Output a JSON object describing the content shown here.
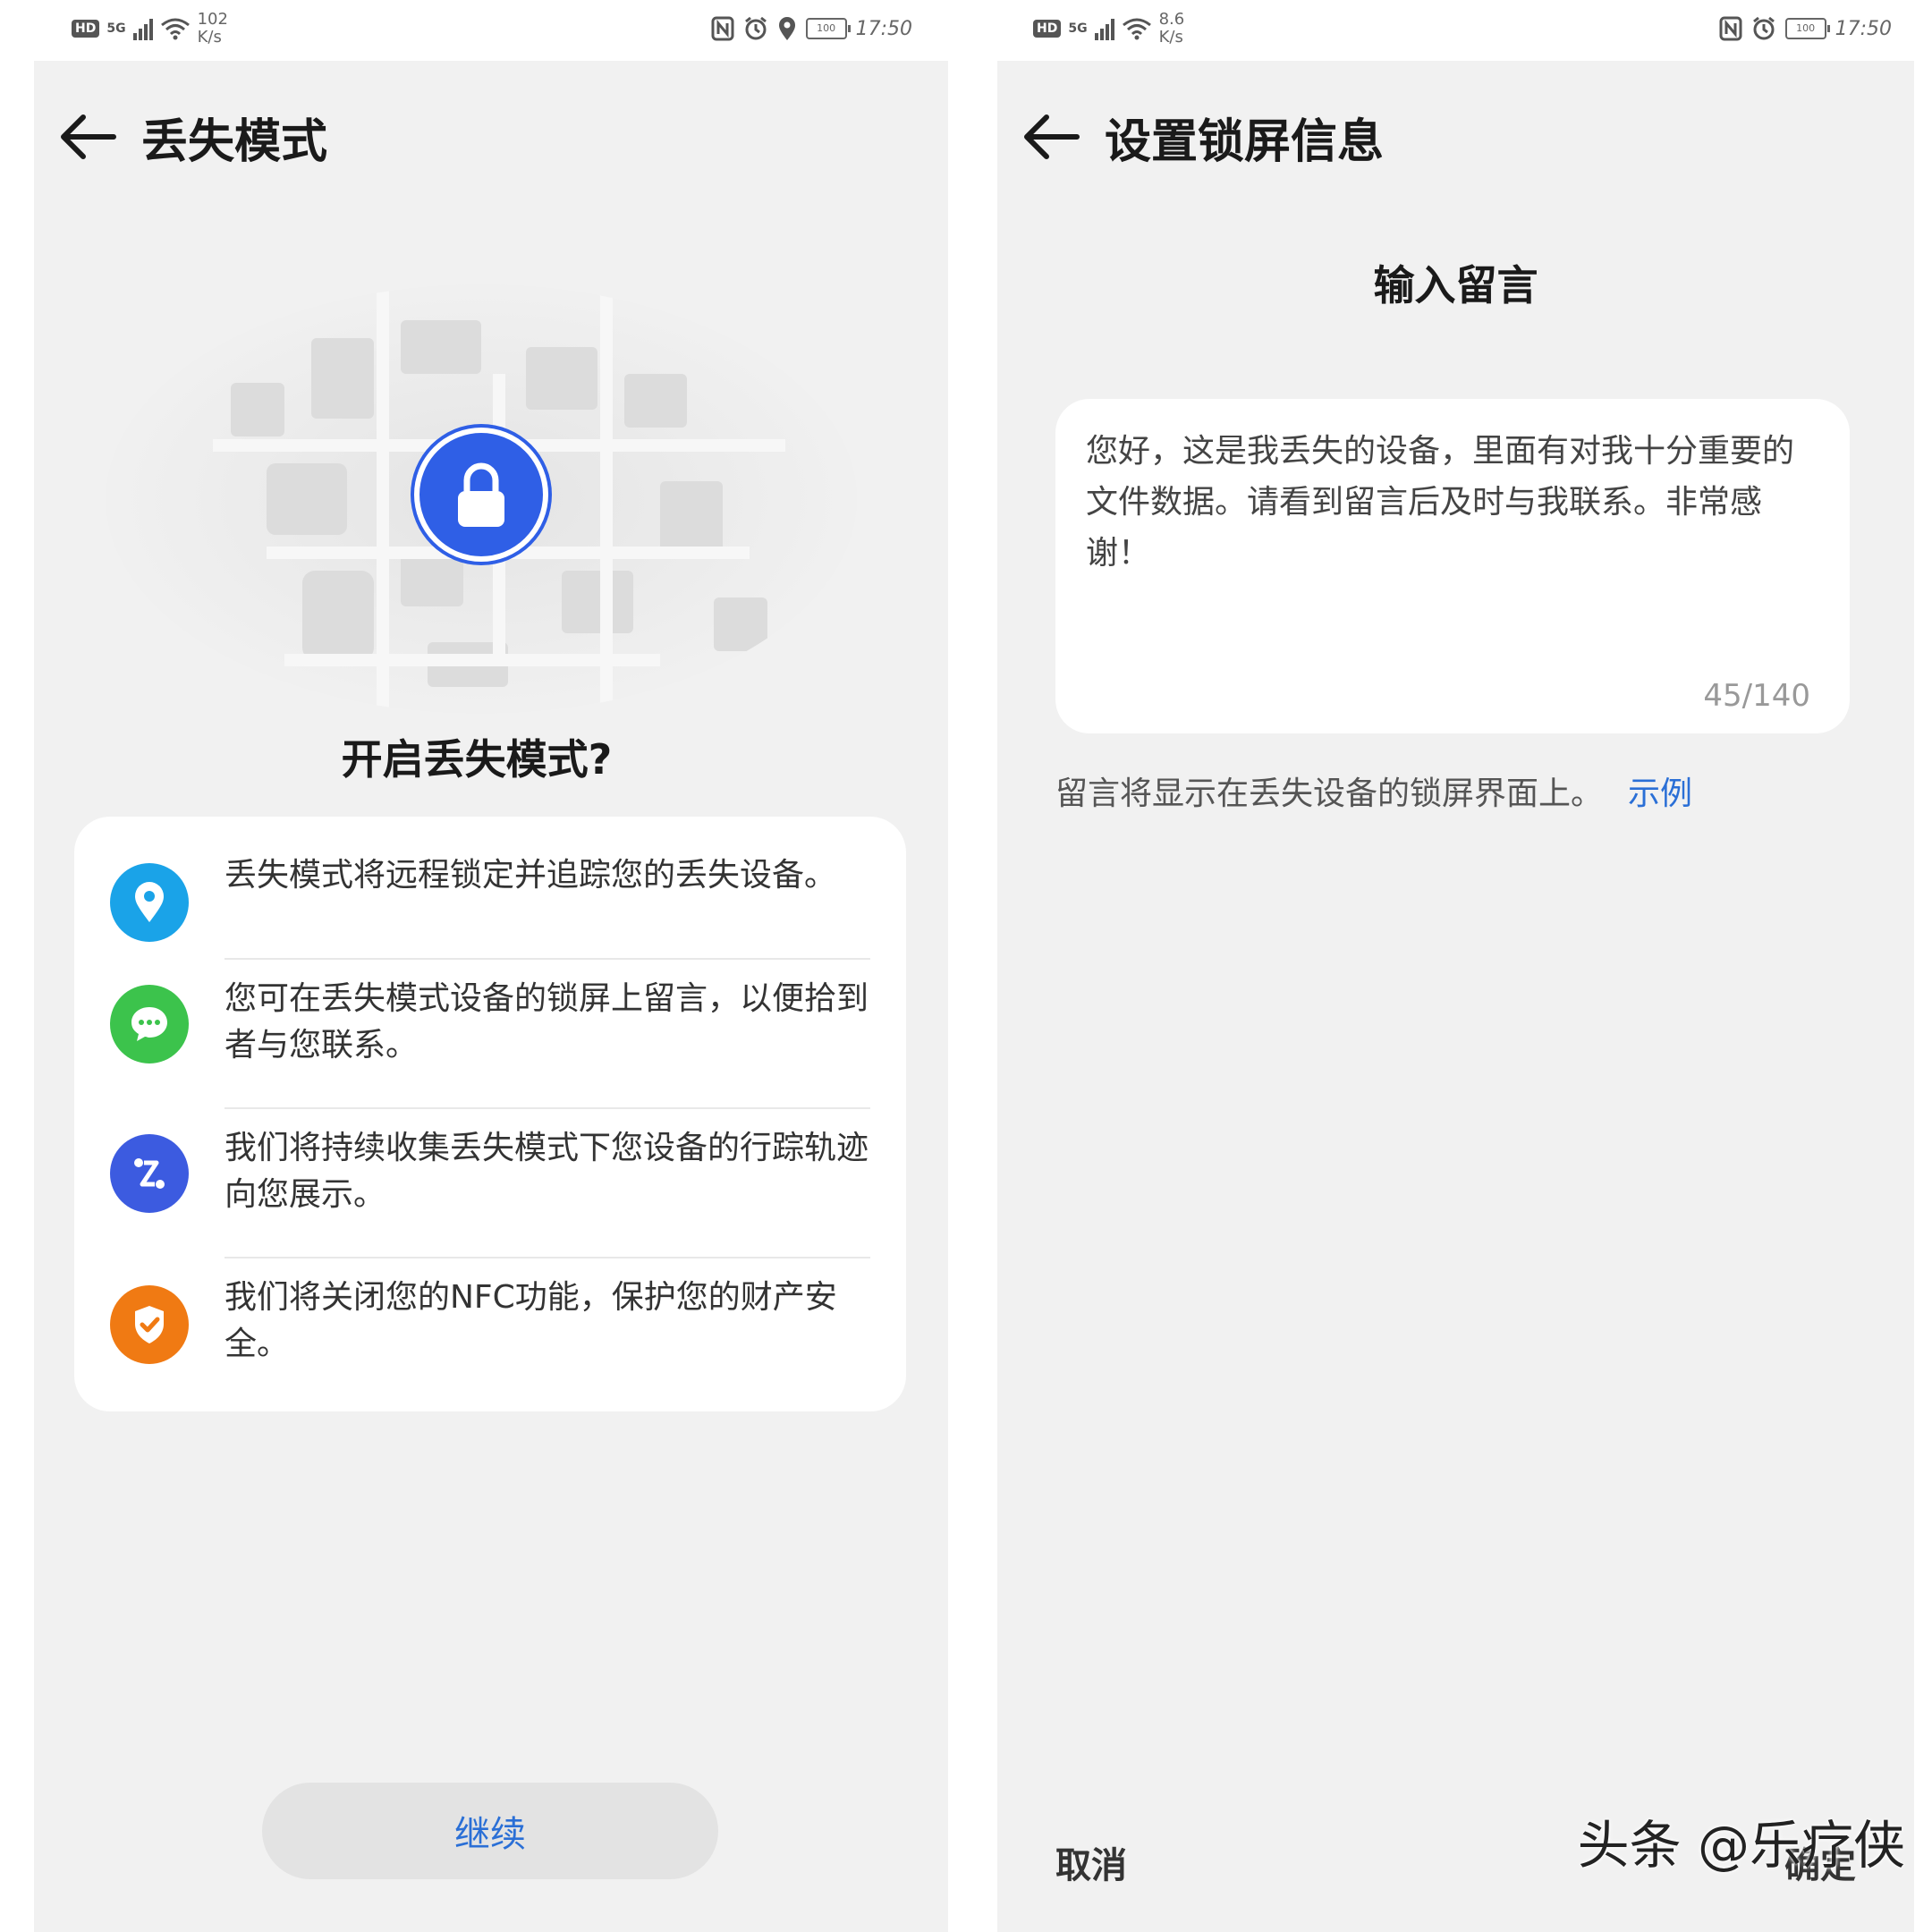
{
  "left": {
    "status": {
      "hd": "HD",
      "net": "5G",
      "speed_value": "102",
      "speed_unit": "K/s",
      "battery": "100",
      "time": "17:50"
    },
    "title": "丢失模式",
    "question": "开启丢失模式?",
    "items": [
      {
        "text": "丢失模式将远程锁定并追踪您的丢失设备。",
        "icon": "location-pin-icon",
        "color": "#1aa3e8"
      },
      {
        "text": "您可在丢失模式设备的锁屏上留言，以便拾到者与您联系。",
        "icon": "message-bubble-icon",
        "color": "#3cc34c"
      },
      {
        "text": "我们将持续收集丢失模式下您设备的行踪轨迹向您展示。",
        "icon": "route-icon",
        "color": "#3c5be0"
      },
      {
        "text": "我们将关闭您的NFC功能，保护您的财产安全。",
        "icon": "shield-check-icon",
        "color": "#f07a13"
      }
    ],
    "continue_label": "继续"
  },
  "right": {
    "status": {
      "hd": "HD",
      "net": "5G",
      "speed_value": "8.6",
      "speed_unit": "K/s",
      "battery": "100",
      "time": "17:50"
    },
    "title": "设置锁屏信息",
    "section_title": "输入留言",
    "message": "您好，这是我丢失的设备，里面有对我十分重要的文件数据。请看到留言后及时与我联系。非常感谢！",
    "counter": "45/140",
    "hint": "留言将显示在丢失设备的锁屏界面上。",
    "example_link": "示例",
    "cancel_label": "取消",
    "ok_label": "确定"
  },
  "watermark": "头条 @乐疗侠",
  "colors": {
    "accent": "#2a6fd6",
    "lock": "#2f5fe6",
    "background": "#f1f1f1"
  }
}
